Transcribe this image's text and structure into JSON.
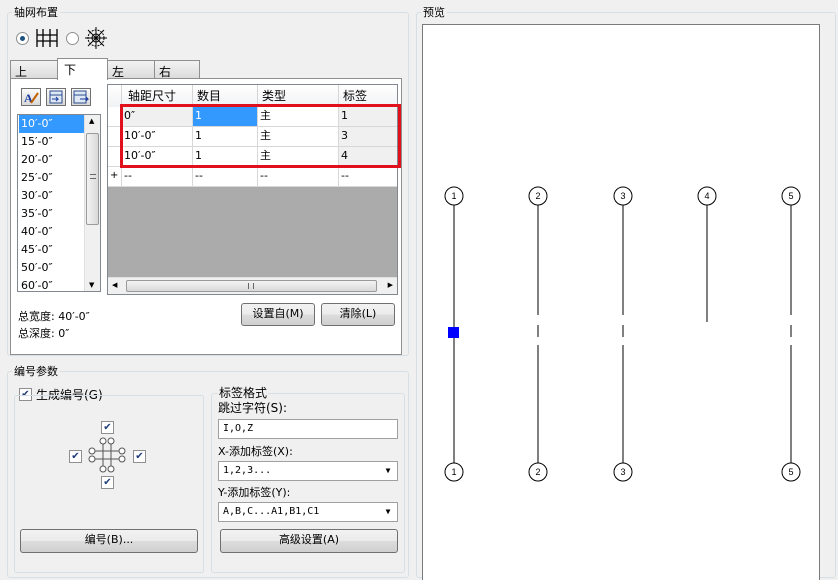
{
  "grid_layout": {
    "legend": "轴网布置",
    "tabs": [
      "上",
      "下",
      "左",
      "右"
    ],
    "active_tab": 1,
    "spacing_list": [
      "10′-0″",
      "15′-0″",
      "20′-0″",
      "25′-0″",
      "30′-0″",
      "35′-0″",
      "40′-0″",
      "45′-0″",
      "50′-0″",
      "60′-0″"
    ],
    "selected_spacing": 0,
    "table": {
      "headers": [
        "轴距尺寸",
        "数目",
        "类型",
        "标签"
      ],
      "rows": [
        [
          "0″",
          "1",
          "主",
          "1"
        ],
        [
          "10′-0″",
          "1",
          "主",
          "3"
        ],
        [
          "10′-0″",
          "1",
          "主",
          "4"
        ]
      ],
      "new_row": [
        "--",
        "--",
        "--",
        "--"
      ],
      "new_row_marker": "+"
    },
    "total_width": "总宽度:  40′-0″",
    "total_depth": "总深度:  0″",
    "set_from_button": "设置自(M)",
    "clear_button": "清除(L)"
  },
  "numbering": {
    "legend": "编号参数",
    "generate_label": "生成编号(G)",
    "generate_checked": true,
    "number_button": "编号(B)...",
    "label_format_title": "标签格式",
    "skip_chars_label": "跳过字符(S):",
    "skip_chars_value": "I,O,Z",
    "x_label": "X-添加标签(X):",
    "x_value": "1,2,3...",
    "y_label": "Y-添加标签(Y):",
    "y_value": "A,B,C...A1,B1,C1",
    "advanced_button": "高级设置(A)"
  },
  "preview": {
    "legend": "预览",
    "top_bubbles": [
      "1",
      "2",
      "3",
      "4",
      "5"
    ],
    "bottom_bubbles": [
      "1",
      "2",
      "3",
      "5"
    ]
  },
  "colors": {
    "selection": "#3399ff",
    "highlight_box": "#e0101c",
    "marker": "#0000ff"
  }
}
